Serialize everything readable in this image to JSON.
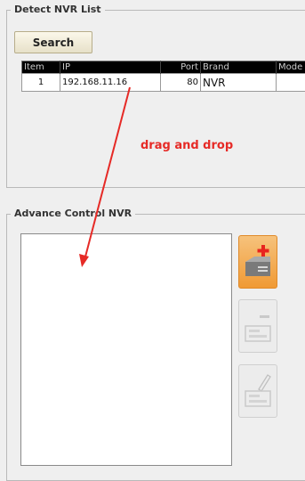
{
  "detect_group": {
    "legend": "Detect NVR List",
    "search_label": "Search",
    "columns": [
      "Item",
      "IP",
      "Port",
      "Brand",
      "Mode"
    ],
    "rows": [
      {
        "item": "1",
        "ip": "192.168.11.16",
        "port": "80",
        "brand": "NVR",
        "model": ""
      }
    ]
  },
  "annotation": {
    "text": "drag and drop",
    "color": "#e62a26"
  },
  "advance_group": {
    "legend": "Advance Control NVR"
  },
  "tool_buttons": [
    {
      "name": "add-nvr-button",
      "icon": "add-device-icon"
    },
    {
      "name": "remove-nvr-button",
      "icon": "remove-device-icon"
    },
    {
      "name": "edit-nvr-button",
      "icon": "edit-device-icon"
    }
  ]
}
